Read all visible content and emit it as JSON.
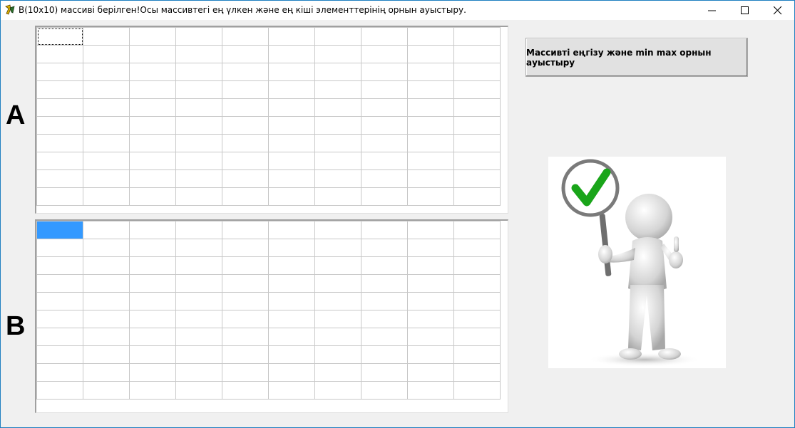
{
  "window": {
    "title": "B(10x10) массиві берілген!Осы массивтегі ең үлкен және ең кіші элементтерінің орнын ауыстыру."
  },
  "labels": {
    "a": "A",
    "b": "B"
  },
  "grids": {
    "rows": 10,
    "cols": 10,
    "a_focused_cell": [
      0,
      0
    ],
    "b_selected_cell": [
      0,
      0
    ]
  },
  "button": {
    "label": "Массивті еңгізу және min max орнын ауыстыру"
  },
  "colors": {
    "selection": "#3399ff",
    "checkmark": "#1aa51a",
    "window_border": "#1f7fc0"
  },
  "icons": {
    "app": "delphi-app-icon",
    "picture": "stick-figure-checkmark-sign"
  }
}
